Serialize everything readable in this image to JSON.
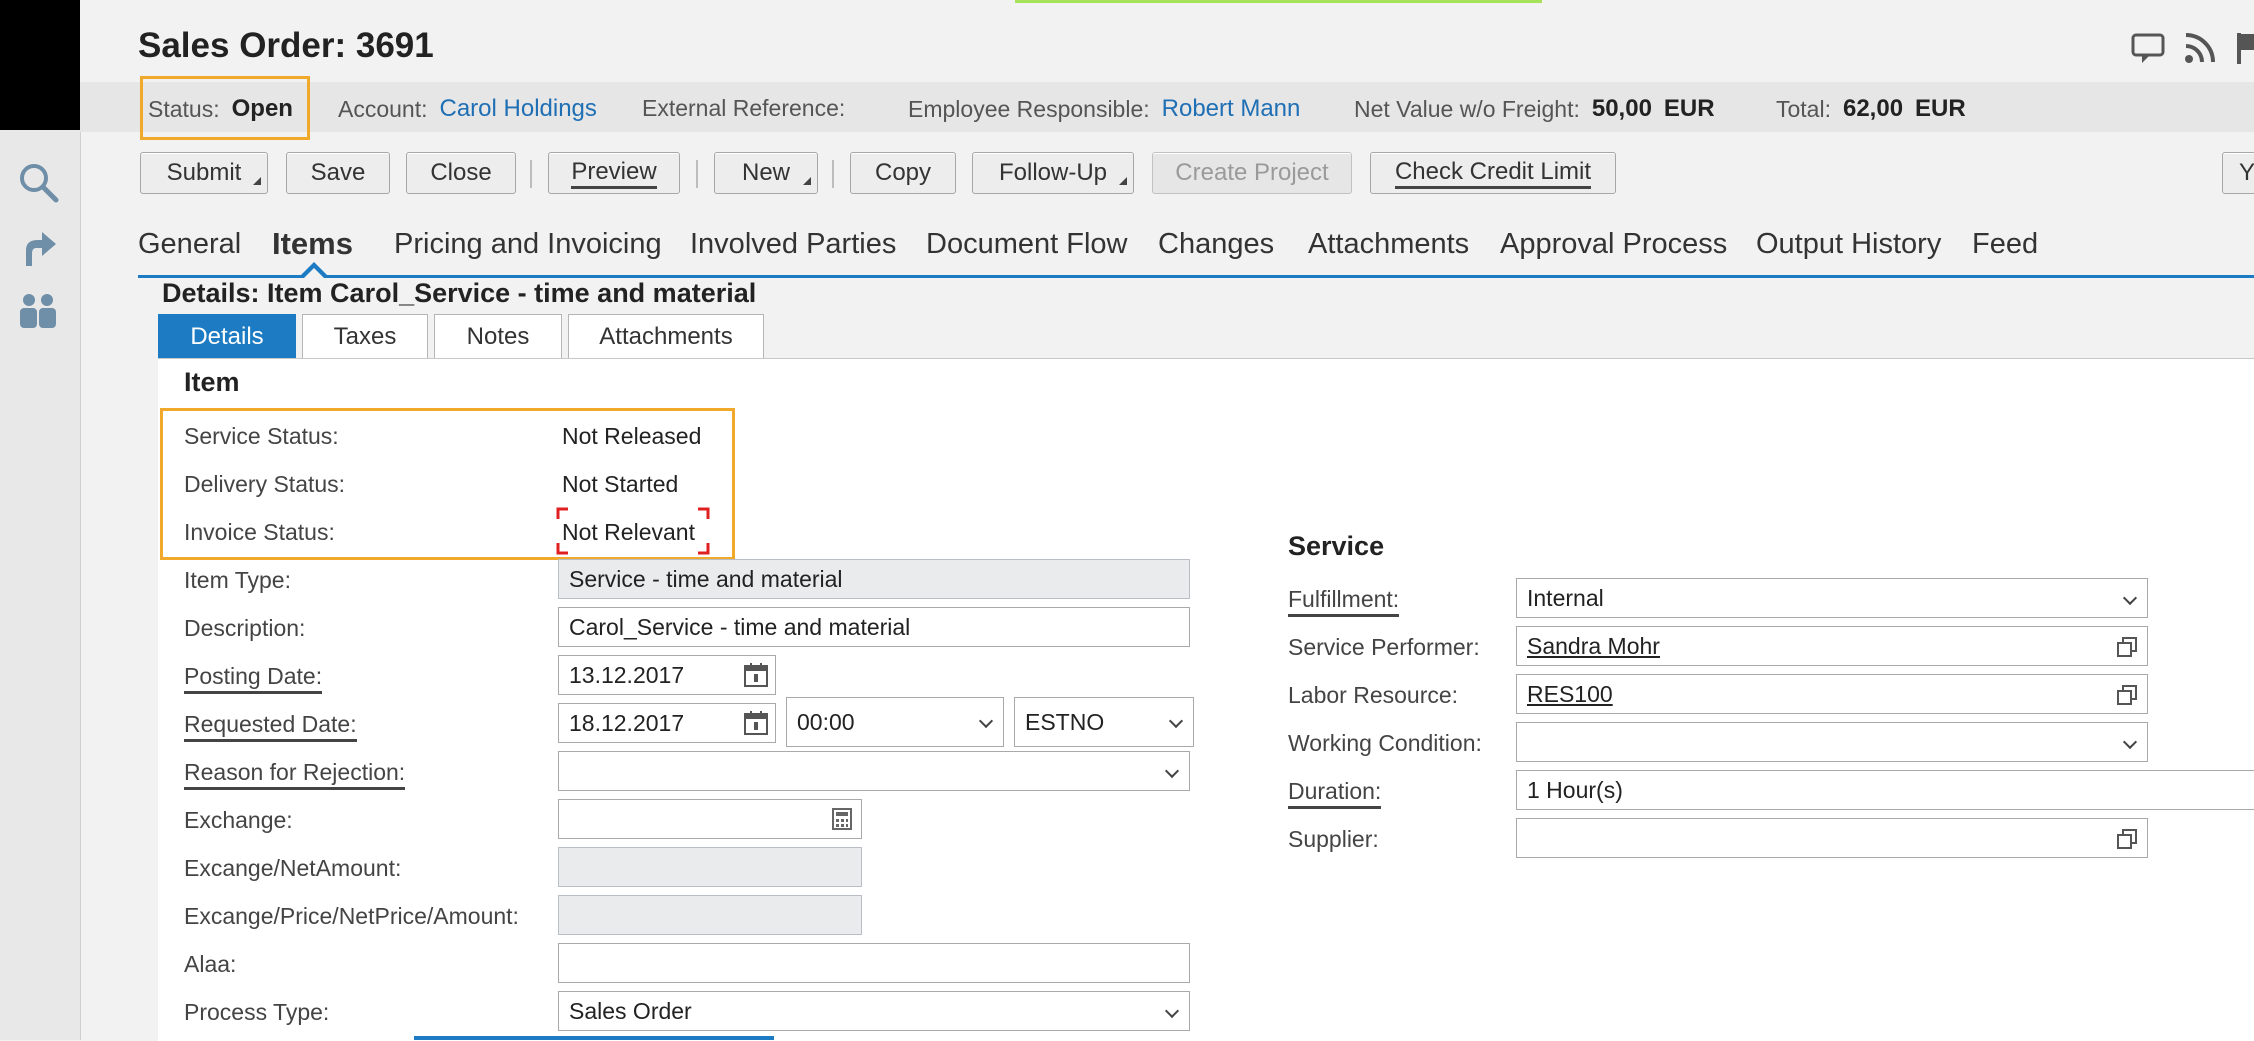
{
  "title": "Sales Order: 3691",
  "header": {
    "status_label": "Status:",
    "status_value": "Open",
    "account_label": "Account:",
    "account_value": "Carol Holdings",
    "external_ref_label": "External Reference:",
    "employee_label": "Employee Responsible:",
    "employee_value": "Robert Mann",
    "net_value_label": "Net Value w/o Freight:",
    "net_value": "50,00",
    "net_currency": "EUR",
    "total_label": "Total:",
    "total_value": "62,00",
    "total_currency": "EUR"
  },
  "toolbar": {
    "submit": "Submit",
    "save": "Save",
    "close": "Close",
    "preview": "Preview",
    "new": "New",
    "copy": "Copy",
    "follow_up": "Follow-Up",
    "create_project": "Create Project",
    "check_credit": "Check Credit Limit",
    "overflow": "Y"
  },
  "tabs": [
    "General",
    "Items",
    "Pricing and Invoicing",
    "Involved Parties",
    "Document Flow",
    "Changes",
    "Attachments",
    "Approval Process",
    "Output History",
    "Feed"
  ],
  "details_title": "Details: Item Carol_Service - time and material",
  "subtabs": [
    "Details",
    "Taxes",
    "Notes",
    "Attachments"
  ],
  "item": {
    "heading": "Item",
    "service_status_label": "Service Status:",
    "service_status_value": "Not Released",
    "delivery_status_label": "Delivery Status:",
    "delivery_status_value": "Not Started",
    "invoice_status_label": "Invoice Status:",
    "invoice_status_value": "Not Relevant",
    "item_type_label": "Item Type:",
    "item_type_value": "Service - time and material",
    "description_label": "Description:",
    "description_value": "Carol_Service - time and material",
    "posting_date_label": "Posting Date:",
    "posting_date_value": "13.12.2017",
    "requested_date_label": "Requested Date:",
    "requested_date_value": "18.12.2017",
    "requested_time_value": "00:00",
    "requested_tz_value": "ESTNO",
    "rejection_label": "Reason for Rejection:",
    "rejection_value": "",
    "exchange_label": "Exchange:",
    "exchange_value": "",
    "exchange_net_label": "Excange/NetAmount:",
    "exchange_price_label": "Excange/Price/NetPrice/Amount:",
    "alaa_label": "Alaa:",
    "alaa_value": "",
    "process_type_label": "Process Type:",
    "process_type_value": "Sales Order"
  },
  "service": {
    "heading": "Service",
    "fulfillment_label": "Fulfillment:",
    "fulfillment_value": "Internal",
    "performer_label": "Service Performer:",
    "performer_value": "Sandra Mohr",
    "labor_label": "Labor Resource:",
    "labor_value": "RES100",
    "working_label": "Working Condition:",
    "working_value": "",
    "duration_label": "Duration:",
    "duration_value": "1 Hour(s)",
    "supplier_label": "Supplier:",
    "supplier_value": ""
  },
  "colors": {
    "accent": "#1c7bc2",
    "highlight": "#f0a92b",
    "link": "#1f6fb5",
    "marker": "#e02020"
  },
  "icons": [
    "search-icon",
    "share-arrow-icon",
    "people-icon",
    "feedback-icon",
    "rss-icon",
    "flag-icon",
    "calendar-icon",
    "calculator-icon",
    "value-help-icon",
    "chevron-down-icon"
  ]
}
